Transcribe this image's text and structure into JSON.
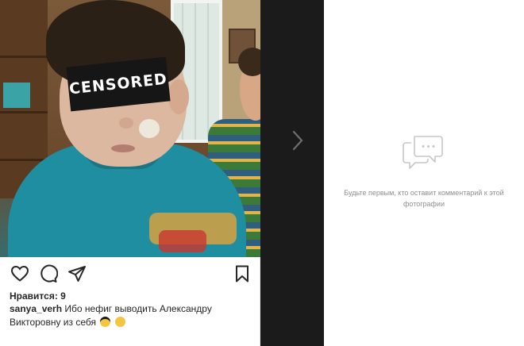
{
  "post": {
    "photo": {
      "censor_label": "CENSORED"
    },
    "actions": {
      "like_icon": "heart-icon",
      "comment_icon": "comment-icon",
      "share_icon": "send-icon",
      "save_icon": "bookmark-icon"
    },
    "likes_text": "Нравится: 9",
    "caption": {
      "username": "sanya_verh",
      "text": "Ибо нефиг выводить Александру Викторовну из себя",
      "emojis": [
        "smiling-face-with-sunglasses-emoji",
        "tired-face-emoji"
      ]
    }
  },
  "navigation": {
    "next_icon": "chevron-right-icon"
  },
  "comments_panel": {
    "empty_icon": "speech-bubbles-icon",
    "empty_text": "Будьте первым, кто оставит комментарий к этой фотографии"
  },
  "colors": {
    "text": "#262626",
    "muted_text": "#8e8e8e",
    "gap_background": "#1b1b1b",
    "censor_bar": "#161616"
  }
}
